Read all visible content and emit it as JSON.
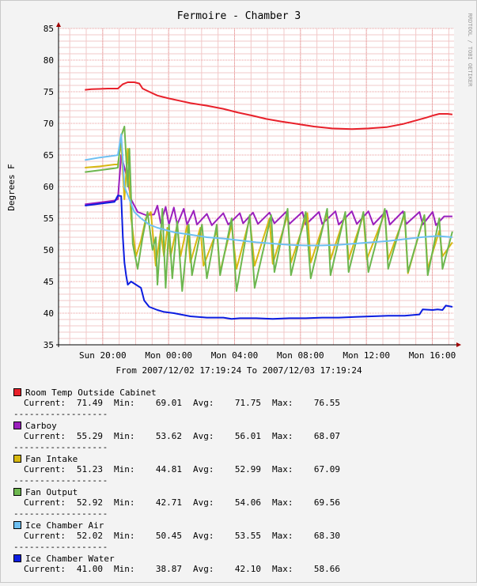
{
  "chart_data": {
    "type": "line",
    "title": "Fermoire - Chamber 3",
    "ylabel": "Degrees F",
    "xlabel": "From 2007/12/02 17:19:24 To 2007/12/03 17:19:24",
    "watermark": "RRDTOOL / TOBI OETIKER",
    "ylim": [
      35,
      85
    ],
    "yticks": [
      35,
      40,
      45,
      50,
      55,
      60,
      65,
      70,
      75,
      80,
      85
    ],
    "x_range_hours": [
      0,
      24
    ],
    "xticks": [
      {
        "label": "Sun 20:00",
        "hour": 2.68
      },
      {
        "label": "Mon 00:00",
        "hour": 6.68
      },
      {
        "label": "Mon 04:00",
        "hour": 10.68
      },
      {
        "label": "Mon 08:00",
        "hour": 14.68
      },
      {
        "label": "Mon 12:00",
        "hour": 18.68
      },
      {
        "label": "Mon 16:00",
        "hour": 22.68
      }
    ],
    "grid": true,
    "series": [
      {
        "name": "Room Temp Outside Cabinet",
        "color": "#e8202a",
        "stats": {
          "current": "71.49",
          "min": "69.01",
          "avg": "71.75",
          "max": "76.55"
        },
        "points": [
          [
            1.6,
            75.3
          ],
          [
            2.0,
            75.4
          ],
          [
            3.0,
            75.5
          ],
          [
            3.6,
            75.5
          ],
          [
            3.9,
            76.2
          ],
          [
            4.2,
            76.5
          ],
          [
            4.6,
            76.5
          ],
          [
            4.9,
            76.3
          ],
          [
            5.1,
            75.5
          ],
          [
            5.5,
            75.0
          ],
          [
            6.0,
            74.4
          ],
          [
            6.6,
            74.0
          ],
          [
            7.3,
            73.6
          ],
          [
            8.0,
            73.2
          ],
          [
            9.0,
            72.8
          ],
          [
            10.0,
            72.3
          ],
          [
            10.9,
            71.7
          ],
          [
            11.8,
            71.2
          ],
          [
            12.6,
            70.7
          ],
          [
            13.5,
            70.3
          ],
          [
            14.5,
            69.9
          ],
          [
            15.5,
            69.5
          ],
          [
            16.6,
            69.2
          ],
          [
            17.8,
            69.1
          ],
          [
            18.8,
            69.2
          ],
          [
            19.9,
            69.4
          ],
          [
            20.9,
            69.9
          ],
          [
            21.6,
            70.4
          ],
          [
            22.3,
            70.9
          ],
          [
            22.8,
            71.3
          ],
          [
            23.1,
            71.5
          ],
          [
            23.6,
            71.5
          ],
          [
            23.9,
            71.4
          ]
        ]
      },
      {
        "name": "Carboy",
        "color": "#9b1fbd",
        "stats": {
          "current": "55.29",
          "min": "53.62",
          "avg": "56.01",
          "max": "68.07"
        },
        "points": [
          [
            1.6,
            57.2
          ],
          [
            2.5,
            57.5
          ],
          [
            3.4,
            57.8
          ],
          [
            3.6,
            58.0
          ],
          [
            3.8,
            65.0
          ],
          [
            4.0,
            63.0
          ],
          [
            4.2,
            61.0
          ],
          [
            4.4,
            58.0
          ],
          [
            4.8,
            56.0
          ],
          [
            5.3,
            55.5
          ],
          [
            5.8,
            55.6
          ],
          [
            6.0,
            57.0
          ],
          [
            6.2,
            54.2
          ],
          [
            6.5,
            56.8
          ],
          [
            6.7,
            54.0
          ],
          [
            7.0,
            56.7
          ],
          [
            7.2,
            54.0
          ],
          [
            7.6,
            56.5
          ],
          [
            7.8,
            54.0
          ],
          [
            8.2,
            56.2
          ],
          [
            8.4,
            54.0
          ],
          [
            9.0,
            55.7
          ],
          [
            9.3,
            53.9
          ],
          [
            10.0,
            55.8
          ],
          [
            10.3,
            54.0
          ],
          [
            11.0,
            55.8
          ],
          [
            11.2,
            54.2
          ],
          [
            11.8,
            55.9
          ],
          [
            12.1,
            54.1
          ],
          [
            12.8,
            55.9
          ],
          [
            13.1,
            54.2
          ],
          [
            13.8,
            56.0
          ],
          [
            14.0,
            54.1
          ],
          [
            14.8,
            56.0
          ],
          [
            15.0,
            54.0
          ],
          [
            15.8,
            56.0
          ],
          [
            16.0,
            54.1
          ],
          [
            16.8,
            56.1
          ],
          [
            17.0,
            54.0
          ],
          [
            17.8,
            56.1
          ],
          [
            18.1,
            54.1
          ],
          [
            18.8,
            56.1
          ],
          [
            19.1,
            54.0
          ],
          [
            19.9,
            56.2
          ],
          [
            20.1,
            54.0
          ],
          [
            20.9,
            56.1
          ],
          [
            21.1,
            54.1
          ],
          [
            21.9,
            56.0
          ],
          [
            22.1,
            54.0
          ],
          [
            22.7,
            56.0
          ],
          [
            22.9,
            53.9
          ],
          [
            23.4,
            55.3
          ],
          [
            23.9,
            55.3
          ]
        ]
      },
      {
        "name": "Fan Intake",
        "color": "#d7b811",
        "stats": {
          "current": "51.23",
          "min": "44.81",
          "avg": "52.99",
          "max": "67.09"
        },
        "points": [
          [
            1.6,
            63.0
          ],
          [
            2.5,
            63.2
          ],
          [
            3.4,
            63.5
          ],
          [
            3.6,
            63.5
          ],
          [
            3.8,
            67.0
          ],
          [
            4.0,
            58.0
          ],
          [
            4.2,
            66.0
          ],
          [
            4.4,
            55.0
          ],
          [
            4.7,
            49.0
          ],
          [
            5.0,
            51.5
          ],
          [
            5.3,
            55.0
          ],
          [
            5.6,
            56.0
          ],
          [
            5.9,
            47.5
          ],
          [
            6.2,
            53.0
          ],
          [
            6.4,
            49.0
          ],
          [
            6.6,
            53.5
          ],
          [
            6.8,
            49.0
          ],
          [
            7.2,
            54.0
          ],
          [
            7.4,
            49.0
          ],
          [
            7.8,
            53.8
          ],
          [
            8.0,
            48.0
          ],
          [
            8.6,
            53.5
          ],
          [
            8.8,
            47.5
          ],
          [
            9.6,
            53.0
          ],
          [
            9.8,
            46.5
          ],
          [
            10.5,
            54.0
          ],
          [
            10.8,
            47.0
          ],
          [
            11.6,
            55.0
          ],
          [
            11.9,
            47.5
          ],
          [
            12.8,
            55.0
          ],
          [
            13.0,
            47.8
          ],
          [
            13.9,
            55.5
          ],
          [
            14.1,
            48.0
          ],
          [
            15.1,
            55.8
          ],
          [
            15.3,
            48.0
          ],
          [
            16.3,
            55.8
          ],
          [
            16.5,
            48.5
          ],
          [
            17.4,
            55.5
          ],
          [
            17.6,
            48.5
          ],
          [
            18.5,
            55.5
          ],
          [
            18.7,
            48.5
          ],
          [
            19.8,
            55.8
          ],
          [
            20.0,
            48.5
          ],
          [
            21.0,
            55.5
          ],
          [
            21.2,
            46.3
          ],
          [
            22.2,
            55.5
          ],
          [
            22.4,
            47.0
          ],
          [
            23.1,
            53.0
          ],
          [
            23.3,
            49.0
          ],
          [
            23.9,
            51.2
          ]
        ]
      },
      {
        "name": "Fan Output",
        "color": "#6db74f",
        "stats": {
          "current": "52.92",
          "min": "42.71",
          "avg": "54.06",
          "max": "69.56"
        },
        "points": [
          [
            1.6,
            62.3
          ],
          [
            2.5,
            62.6
          ],
          [
            3.4,
            62.9
          ],
          [
            3.6,
            63.0
          ],
          [
            3.8,
            68.0
          ],
          [
            4.0,
            69.5
          ],
          [
            4.2,
            60.0
          ],
          [
            4.3,
            66.0
          ],
          [
            4.5,
            51.0
          ],
          [
            4.8,
            47.0
          ],
          [
            5.1,
            52.0
          ],
          [
            5.4,
            56.0
          ],
          [
            5.7,
            50.0
          ],
          [
            5.9,
            52.0
          ],
          [
            6.0,
            44.5
          ],
          [
            6.3,
            56.5
          ],
          [
            6.5,
            44.0
          ],
          [
            6.7,
            54.0
          ],
          [
            6.9,
            45.5
          ],
          [
            7.2,
            54.5
          ],
          [
            7.5,
            43.5
          ],
          [
            7.9,
            54.0
          ],
          [
            8.1,
            46.0
          ],
          [
            8.7,
            54.0
          ],
          [
            9.0,
            45.5
          ],
          [
            9.6,
            54.0
          ],
          [
            9.8,
            46.0
          ],
          [
            10.5,
            55.0
          ],
          [
            10.8,
            43.5
          ],
          [
            11.6,
            55.5
          ],
          [
            11.9,
            44.0
          ],
          [
            12.9,
            55.5
          ],
          [
            13.1,
            46.5
          ],
          [
            13.9,
            56.5
          ],
          [
            14.1,
            46.0
          ],
          [
            15.0,
            56.0
          ],
          [
            15.3,
            45.5
          ],
          [
            16.3,
            56.5
          ],
          [
            16.5,
            46.0
          ],
          [
            17.4,
            56.0
          ],
          [
            17.6,
            46.5
          ],
          [
            18.5,
            56.0
          ],
          [
            18.8,
            46.5
          ],
          [
            19.8,
            56.5
          ],
          [
            20.0,
            47.0
          ],
          [
            21.0,
            56.0
          ],
          [
            21.2,
            46.5
          ],
          [
            22.2,
            55.5
          ],
          [
            22.4,
            46.0
          ],
          [
            23.1,
            55.0
          ],
          [
            23.3,
            47.0
          ],
          [
            23.9,
            52.9
          ]
        ]
      },
      {
        "name": "Ice Chamber Air",
        "color": "#6ec0f2",
        "stats": {
          "current": "52.02",
          "min": "50.45",
          "avg": "53.55",
          "max": "68.30"
        },
        "points": [
          [
            1.6,
            64.2
          ],
          [
            2.5,
            64.6
          ],
          [
            3.4,
            64.9
          ],
          [
            3.6,
            65.0
          ],
          [
            3.8,
            68.3
          ],
          [
            4.0,
            60.0
          ],
          [
            4.3,
            58.0
          ],
          [
            4.6,
            56.0
          ],
          [
            5.0,
            55.0
          ],
          [
            5.5,
            54.0
          ],
          [
            6.0,
            53.5
          ],
          [
            7.0,
            52.8
          ],
          [
            8.0,
            52.4
          ],
          [
            9.0,
            52.0
          ],
          [
            10.0,
            51.8
          ],
          [
            11.0,
            51.5
          ],
          [
            12.0,
            51.2
          ],
          [
            13.0,
            51.0
          ],
          [
            14.0,
            50.8
          ],
          [
            15.0,
            50.7
          ],
          [
            16.0,
            50.7
          ],
          [
            17.0,
            50.8
          ],
          [
            18.0,
            51.0
          ],
          [
            19.0,
            51.2
          ],
          [
            20.0,
            51.4
          ],
          [
            21.0,
            51.7
          ],
          [
            22.0,
            52.0
          ],
          [
            23.0,
            52.2
          ],
          [
            23.9,
            52.0
          ]
        ]
      },
      {
        "name": "Ice Chamber Water",
        "color": "#0c1de0",
        "stats": {
          "current": "41.00",
          "min": "38.87",
          "avg": "42.10",
          "max": "58.66"
        },
        "points": [
          [
            1.6,
            57.0
          ],
          [
            2.5,
            57.3
          ],
          [
            3.4,
            57.6
          ],
          [
            3.6,
            58.6
          ],
          [
            3.8,
            58.5
          ],
          [
            3.9,
            52.0
          ],
          [
            4.0,
            48.0
          ],
          [
            4.1,
            46.0
          ],
          [
            4.2,
            44.5
          ],
          [
            4.4,
            45.0
          ],
          [
            4.7,
            44.5
          ],
          [
            5.0,
            44.0
          ],
          [
            5.2,
            42.0
          ],
          [
            5.5,
            41.0
          ],
          [
            6.0,
            40.5
          ],
          [
            6.4,
            40.2
          ],
          [
            7.0,
            40.0
          ],
          [
            8.0,
            39.5
          ],
          [
            9.0,
            39.3
          ],
          [
            10.0,
            39.3
          ],
          [
            10.5,
            39.1
          ],
          [
            11.0,
            39.2
          ],
          [
            12.0,
            39.2
          ],
          [
            13.0,
            39.1
          ],
          [
            14.0,
            39.2
          ],
          [
            15.0,
            39.2
          ],
          [
            16.0,
            39.3
          ],
          [
            17.0,
            39.3
          ],
          [
            18.0,
            39.4
          ],
          [
            19.0,
            39.5
          ],
          [
            20.0,
            39.6
          ],
          [
            21.0,
            39.6
          ],
          [
            21.9,
            39.8
          ],
          [
            22.1,
            40.6
          ],
          [
            22.7,
            40.5
          ],
          [
            23.0,
            40.6
          ],
          [
            23.3,
            40.5
          ],
          [
            23.5,
            41.2
          ],
          [
            23.9,
            41.0
          ]
        ]
      }
    ]
  },
  "legend_labels": {
    "current": "Current:",
    "min": "Min:",
    "avg": "Avg:",
    "max": "Max:"
  },
  "separator": "------------------"
}
